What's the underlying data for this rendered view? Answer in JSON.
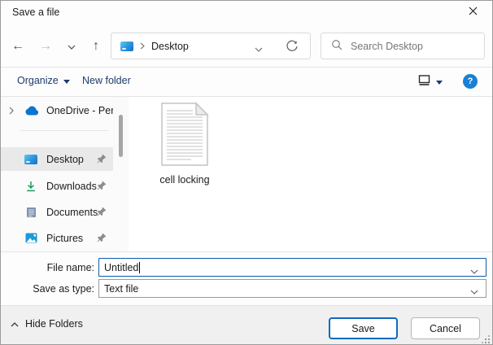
{
  "window": {
    "title": "Save a file"
  },
  "navigation": {
    "address": {
      "location": "Desktop"
    },
    "search": {
      "placeholder": "Search Desktop"
    }
  },
  "toolbar": {
    "organize": "Organize",
    "new_folder": "New folder"
  },
  "sidebar": {
    "items": [
      {
        "label": "OneDrive - Perso"
      },
      {
        "label": "Desktop"
      },
      {
        "label": "Downloads"
      },
      {
        "label": "Documents"
      },
      {
        "label": "Pictures"
      }
    ]
  },
  "content": {
    "files": [
      {
        "name": "cell locking"
      }
    ]
  },
  "fields": {
    "file_name_label": "File name:",
    "file_name_value": "Untitled",
    "save_as_type_label": "Save as type:",
    "save_as_type_value": "Text file"
  },
  "footer": {
    "hide_folders": "Hide Folders",
    "save": "Save",
    "cancel": "Cancel"
  },
  "help_label": "?",
  "colors": {
    "accent": "#0b5cab",
    "toolbar_text": "#1b3a6b",
    "help_icon_bg": "#1b7fd4",
    "onedrive_blue": "#0a74d1",
    "downloads_green": "#1d9b5e",
    "selected_item_bg": "#e9e9e9",
    "footer_bg": "#f0f0f0"
  }
}
